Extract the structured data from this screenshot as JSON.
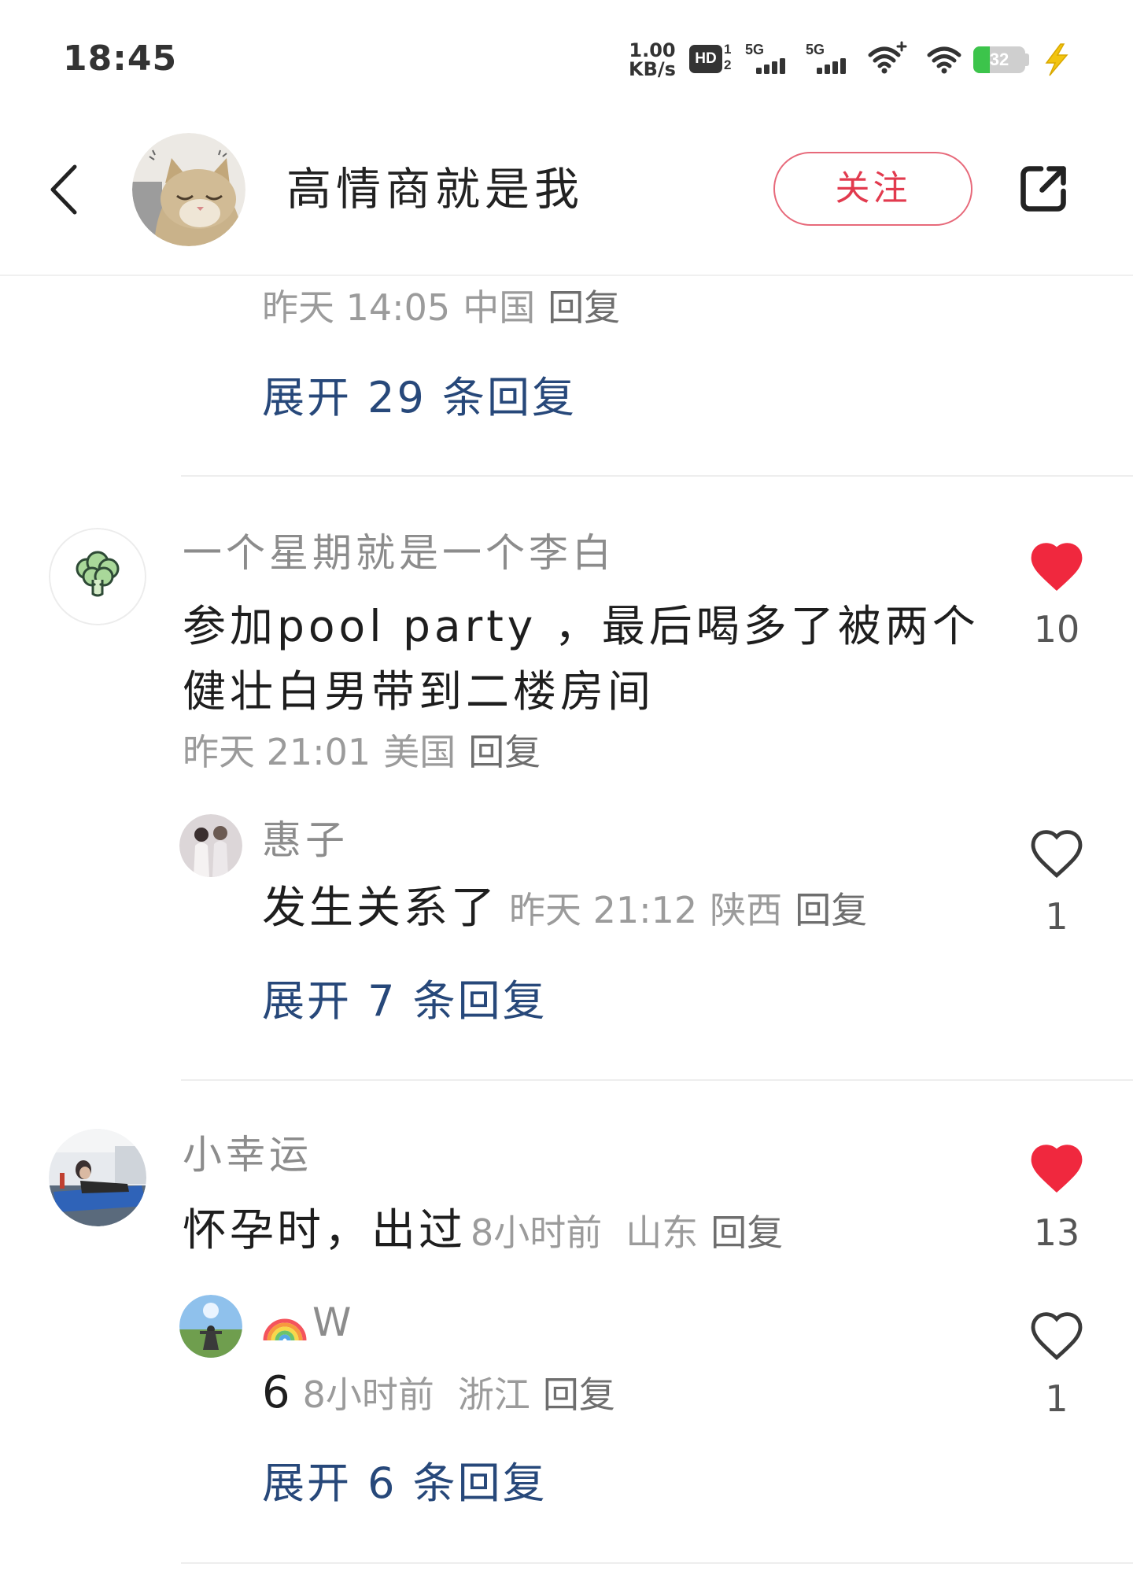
{
  "status_bar": {
    "time": "18:45",
    "net_speed_value": "1.00",
    "net_speed_unit": "KB/s",
    "hd_label": "HD",
    "hd_slot_top": "1",
    "hd_slot_bottom": "2",
    "sim1_network": "5G",
    "sim2_network": "5G",
    "battery_level": "32",
    "icons": [
      "signal-bars-icon",
      "wifi-plus-icon",
      "wifi-icon",
      "battery-icon",
      "charging-bolt-icon"
    ]
  },
  "header": {
    "back_icon": "chevron-left-icon",
    "author_name": "高情商就是我",
    "follow_label": "关注",
    "share_icon": "share-external-icon"
  },
  "thread_tail": {
    "time": "昨天 14:05",
    "location": "中国",
    "reply_label": "回复",
    "expand_label": "展开 29 条回复"
  },
  "comments": [
    {
      "user": "一个星期就是一个李白",
      "text_lines": [
        "参加pool party ，最后喝多了被两个",
        "健壮白男带到二楼房间"
      ],
      "time": "昨天 21:01",
      "location": "美国",
      "reply_label": "回复",
      "likes": "10",
      "liked": true,
      "reply": {
        "user": "惠子",
        "text": "发生关系了",
        "time": "昨天 21:12",
        "location": "陕西",
        "reply_label": "回复",
        "likes": "1",
        "liked": false
      },
      "expand_label": "展开 7 条回复"
    },
    {
      "user": "小幸运",
      "text": "怀孕时，出过",
      "time": "8小时前",
      "location": "山东",
      "reply_label": "回复",
      "likes": "13",
      "liked": true,
      "reply": {
        "user_emoji_icon": "rainbow-icon",
        "user": "W",
        "text": "6",
        "time": "8小时前",
        "location": "浙江",
        "reply_label": "回复",
        "likes": "1",
        "liked": false
      },
      "expand_label": "展开 6 条回复"
    }
  ],
  "icons": {
    "like": "heart-icon"
  },
  "colors": {
    "accent_red": "#f0283e",
    "follow_red": "#e23a4e",
    "link_blue": "#27487a",
    "meta_gray": "#9b9b9b",
    "name_gray": "#8c8c8c",
    "battery_green": "#3cc44b",
    "charge_yellow": "#f2c40f"
  }
}
